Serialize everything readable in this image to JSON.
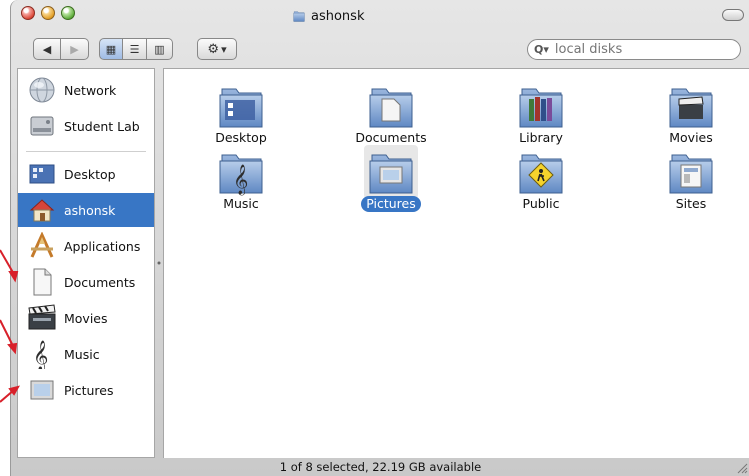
{
  "window": {
    "title": "ashonsk"
  },
  "toolbar": {
    "back_glyph": "◀",
    "forward_glyph": "▶",
    "view_icon_glyph": "▦",
    "view_list_glyph": "☰",
    "view_column_glyph": "▥",
    "action_glyph": "⚙",
    "action_menu_glyph": "▾",
    "search_placeholder": "local disks",
    "search_icon_glyph": "Q▾"
  },
  "sidebar": {
    "items": [
      {
        "label": "Network",
        "icon": "network-globe-icon"
      },
      {
        "label": "Student Lab",
        "icon": "hard-drive-icon"
      },
      {
        "label": "Desktop",
        "icon": "desktop-icon"
      },
      {
        "label": "ashonsk",
        "icon": "home-icon",
        "selected": true
      },
      {
        "label": "Applications",
        "icon": "applications-icon"
      },
      {
        "label": "Documents",
        "icon": "document-icon"
      },
      {
        "label": "Movies",
        "icon": "clapperboard-icon"
      },
      {
        "label": "Music",
        "icon": "music-clef-icon"
      },
      {
        "label": "Pictures",
        "icon": "picture-frame-icon"
      }
    ]
  },
  "content": {
    "folders": [
      {
        "label": "Desktop",
        "icon": "desktop-folder-icon"
      },
      {
        "label": "Documents",
        "icon": "documents-folder-icon"
      },
      {
        "label": "Library",
        "icon": "library-folder-icon"
      },
      {
        "label": "Movies",
        "icon": "movies-folder-icon"
      },
      {
        "label": "Music",
        "icon": "music-folder-icon"
      },
      {
        "label": "Pictures",
        "icon": "pictures-folder-icon",
        "selected": true
      },
      {
        "label": "Public",
        "icon": "public-folder-icon"
      },
      {
        "label": "Sites",
        "icon": "sites-folder-icon"
      }
    ]
  },
  "status": {
    "text": "1 of 8 selected, 22.19 GB available"
  },
  "colors": {
    "selection": "#3876c5",
    "annotation_arrow": "#d8202a",
    "folder_blue": "#7ea6d8"
  }
}
